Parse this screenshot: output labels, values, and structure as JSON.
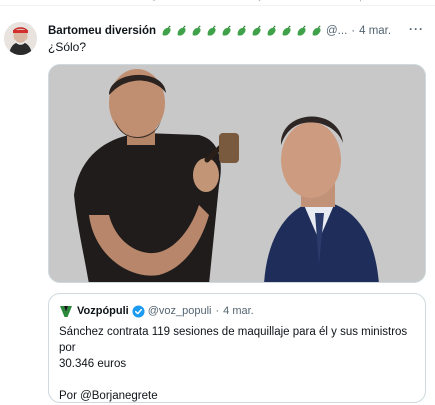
{
  "tweet": {
    "author_name": "Bartomeu diversión",
    "handle": "@...",
    "separator": "·",
    "date": "4 mar.",
    "more": "···",
    "text": "¿Sólo?"
  },
  "quote": {
    "author_name": "Vozpópuli",
    "handle": "@voz_populi",
    "separator": "·",
    "date": "4 mar.",
    "line1": "Sánchez contrata 119 sesiones de maquillaje para él y sus ministros por",
    "line2": "30.346 euros",
    "line3": "Por @Borjanegrete",
    "line4": "..."
  },
  "icons": {
    "emoji": "pepper-emoji-icon",
    "verified": "verified-badge-icon",
    "logo": "vozpopuli-logo-icon",
    "more": "more-options-icon"
  },
  "colors": {
    "verified_blue": "#1d9bf0",
    "secondary_text": "#536471",
    "emoji_green": "#3fa14a",
    "vozpopuli_green": "#2a8a3a",
    "border": "#cfd9de"
  }
}
